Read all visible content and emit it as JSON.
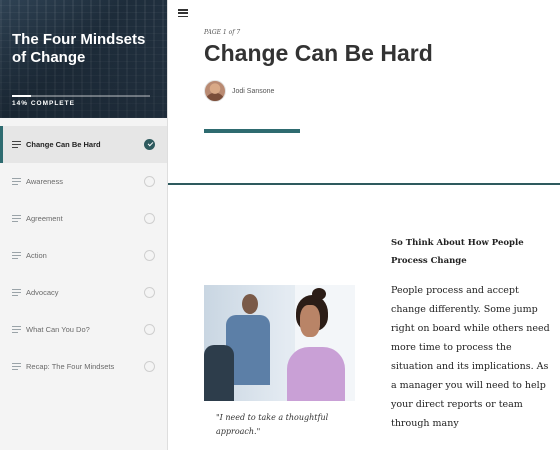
{
  "sidebar": {
    "course_title": "The Four Mindsets of Change",
    "progress": {
      "label": "14% COMPLETE",
      "fraction": 0.14
    },
    "lessons": [
      {
        "label": "Change Can Be Hard",
        "active": true,
        "complete": true
      },
      {
        "label": "Awareness",
        "active": false,
        "complete": false
      },
      {
        "label": "Agreement",
        "active": false,
        "complete": false
      },
      {
        "label": "Action",
        "active": false,
        "complete": false
      },
      {
        "label": "Advocacy",
        "active": false,
        "complete": false
      },
      {
        "label": "What Can You Do?",
        "active": false,
        "complete": false
      },
      {
        "label": "Recap: The Four Mindsets",
        "active": false,
        "complete": false
      }
    ]
  },
  "main": {
    "page_indicator": "PAGE 1 of 7",
    "title": "Change Can Be Hard",
    "author": "Jodi Sansone",
    "image_caption": "\"I need to take a thoughtful approach.\"",
    "section_heading": "So Think About How People Process Change",
    "body": "People process and accept change differently. Some jump right on board while others need more time to process the situation and its implications.  As a manager you will need to help your direct reports or team through many"
  },
  "colors": {
    "accent": "#2e6b70",
    "divider": "#2e5a5e"
  }
}
